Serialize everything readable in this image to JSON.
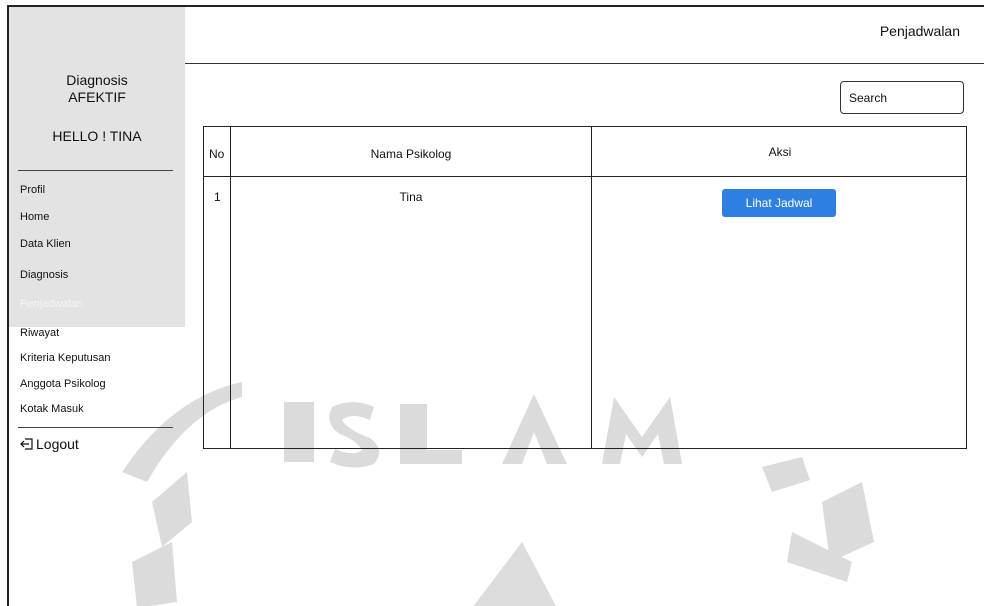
{
  "header": {
    "page_title": "Penjadwalan"
  },
  "sidebar": {
    "brand_line1": "Diagnosis",
    "brand_line2": "AFEKTIF",
    "greeting": "HELLO ! TINA",
    "items": [
      {
        "label": "Profil",
        "active": false
      },
      {
        "label": "Home",
        "active": false
      },
      {
        "label": "Data Klien",
        "active": false
      },
      {
        "label": "Diagnosis",
        "active": false
      },
      {
        "label": "Penjadwalan",
        "active": true
      },
      {
        "label": "Riwayat",
        "active": false
      },
      {
        "label": "Kriteria Keputusan",
        "active": false
      },
      {
        "label": "Anggota Psikolog",
        "active": false
      },
      {
        "label": "Kotak Masuk",
        "active": false
      }
    ],
    "logout_label": "Logout",
    "logout_icon": "logout-icon"
  },
  "search": {
    "placeholder": "Search"
  },
  "table": {
    "headers": {
      "no": "No",
      "name": "Nama Psikolog",
      "action": "Aksi"
    },
    "rows": [
      {
        "no": "1",
        "name": "Tina",
        "action_label": "Lihat Jadwal"
      }
    ]
  },
  "colors": {
    "sidebar_bg": "#e3e3e3",
    "accent": "#2d7fe0"
  }
}
